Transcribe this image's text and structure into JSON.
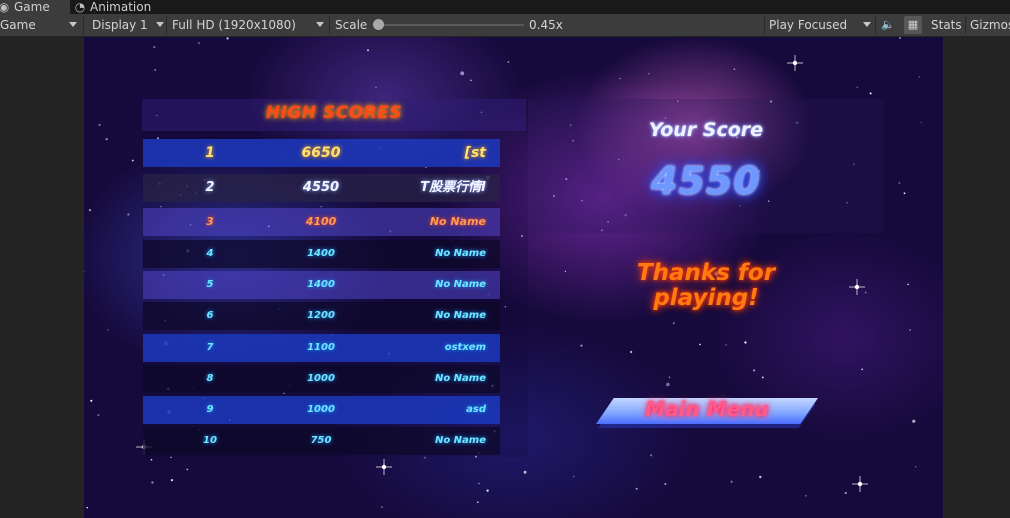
{
  "tabs": [
    {
      "label": "Game",
      "icon": "gamepad-icon",
      "active": true
    },
    {
      "label": "Animation",
      "icon": "clock-icon",
      "active": false
    }
  ],
  "toolbar": {
    "view_mode": "Game",
    "display": "Display 1",
    "resolution": "Full HD (1920x1080)",
    "scale_label": "Scale",
    "scale_value": "0.45x",
    "play_mode": "Play Focused",
    "stats_label": "Stats",
    "gizmos_label": "Gizmos"
  },
  "highscores": {
    "title": "HIGH SCORES",
    "rows": [
      {
        "rank": "1",
        "score": "6650",
        "name": "[st"
      },
      {
        "rank": "2",
        "score": "4550",
        "name": "T股票行情I"
      },
      {
        "rank": "3",
        "score": "4100",
        "name": "No Name"
      },
      {
        "rank": "4",
        "score": "1400",
        "name": "No Name"
      },
      {
        "rank": "5",
        "score": "1400",
        "name": "No Name"
      },
      {
        "rank": "6",
        "score": "1200",
        "name": "No Name"
      },
      {
        "rank": "7",
        "score": "1100",
        "name": "ostxem"
      },
      {
        "rank": "8",
        "score": "1000",
        "name": "No Name"
      },
      {
        "rank": "9",
        "score": "1000",
        "name": "asd"
      },
      {
        "rank": "10",
        "score": "750",
        "name": "No Name"
      }
    ]
  },
  "result": {
    "your_score_label": "Your Score",
    "score": "4550",
    "thanks_line1": "Thanks for",
    "thanks_line2": "playing!",
    "main_menu_label": "Main Menu"
  },
  "colors": {
    "editor_bg": "#3c3c3c",
    "title_orange": "#ff4b18",
    "score_blue": "#6f98ff",
    "row_blue": "#1c3cc8"
  }
}
